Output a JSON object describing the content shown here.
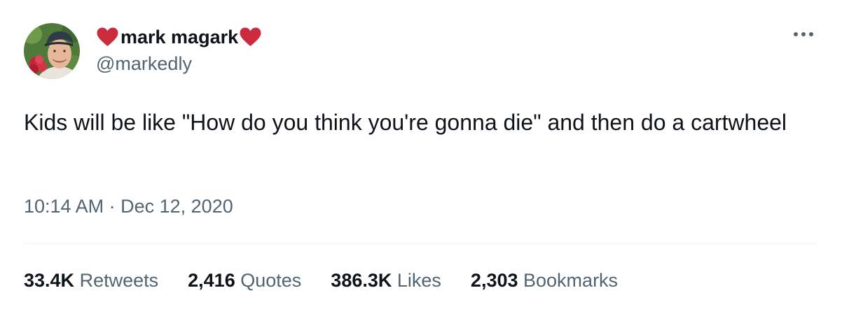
{
  "author": {
    "display_name": "mark magark",
    "handle": "@markedly",
    "name_decoration_color": "#cc2a3d",
    "avatar_icon": "avatar-photo"
  },
  "tweet": {
    "text": "Kids will be like \"How do you think you're gonna die\" and then do a cartwheel",
    "time": "10:14 AM",
    "separator": "·",
    "date": "Dec 12, 2020"
  },
  "stats": [
    {
      "count": "33.4K",
      "label": "Retweets"
    },
    {
      "count": "2,416",
      "label": "Quotes"
    },
    {
      "count": "386.3K",
      "label": "Likes"
    },
    {
      "count": "2,303",
      "label": "Bookmarks"
    }
  ],
  "icons": {
    "more": "more-horizontal-icon",
    "heart": "heart-icon"
  },
  "colors": {
    "text_primary": "#0f1419",
    "text_secondary": "#536471",
    "divider": "#eff3f4",
    "heart": "#cc2a3d"
  }
}
